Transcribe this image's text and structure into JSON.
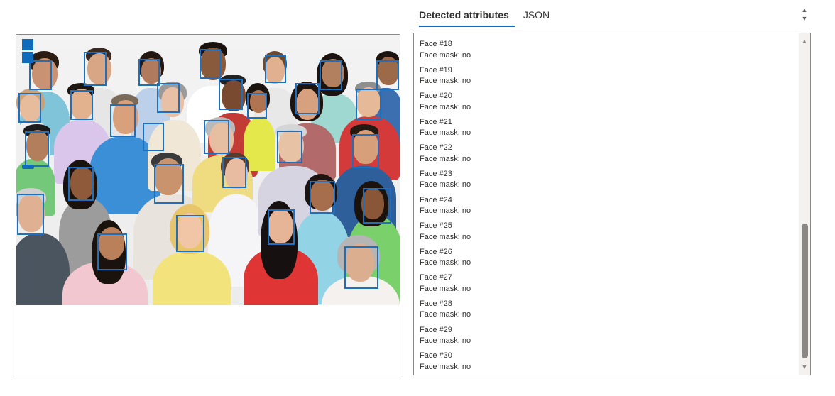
{
  "tabs": [
    {
      "label": "Detected attributes",
      "active": true
    },
    {
      "label": "JSON",
      "active": false
    }
  ],
  "sort_icon": "sort-arrows-icon",
  "image_panel": {
    "zoom_controls": [
      "zoom-in-button",
      "zoom-out-button"
    ],
    "face_box_color": "#1f6fbf",
    "detected_face_count_visible": 30
  },
  "faces": [
    {
      "title": "Face #18",
      "attribute": "Face mask: no"
    },
    {
      "title": "Face #19",
      "attribute": "Face mask: no"
    },
    {
      "title": "Face #20",
      "attribute": "Face mask: no"
    },
    {
      "title": "Face #21",
      "attribute": "Face mask: no"
    },
    {
      "title": "Face #22",
      "attribute": "Face mask: no"
    },
    {
      "title": "Face #23",
      "attribute": "Face mask: no"
    },
    {
      "title": "Face #24",
      "attribute": "Face mask: no"
    },
    {
      "title": "Face #25",
      "attribute": "Face mask: no"
    },
    {
      "title": "Face #26",
      "attribute": "Face mask: no"
    },
    {
      "title": "Face #27",
      "attribute": "Face mask: no"
    },
    {
      "title": "Face #28",
      "attribute": "Face mask: no"
    },
    {
      "title": "Face #29",
      "attribute": "Face mask: no"
    },
    {
      "title": "Face #30",
      "attribute": "Face mask: no"
    }
  ],
  "colors": {
    "accent": "#0f6cbd",
    "border": "#8a8886",
    "text": "#323130"
  }
}
